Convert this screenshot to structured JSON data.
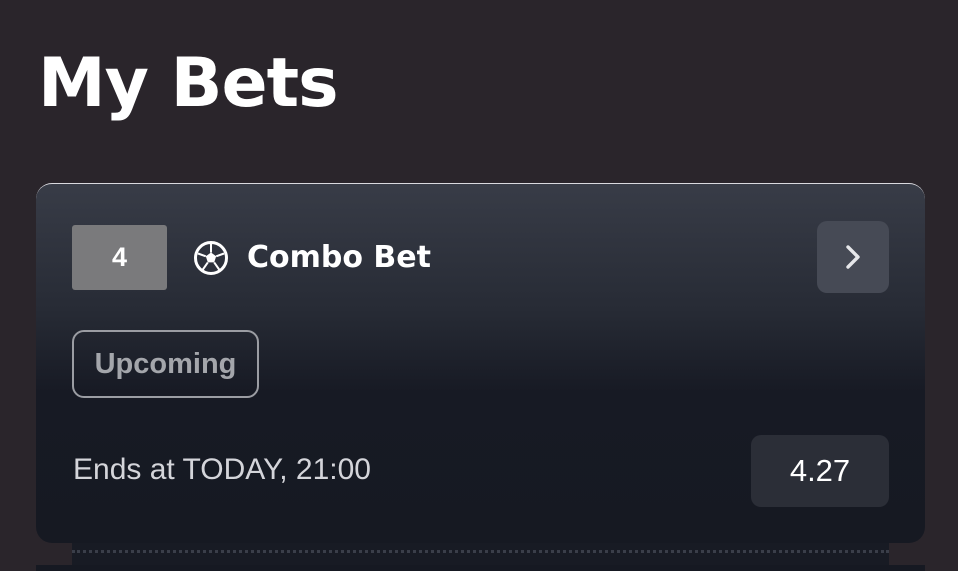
{
  "header": {
    "title": "My Bets"
  },
  "bet_card": {
    "selections_count": "4",
    "sport_icon": "soccer-ball-icon",
    "bet_type": "Combo Bet",
    "details_icon": "chevron-right-icon",
    "status": "Upcoming",
    "ends_at": "Ends at TODAY, 21:00",
    "odds": "4.27"
  },
  "colors": {
    "background": "#2a252b",
    "card_top": "#383c47",
    "card_bottom": "#161922",
    "count_badge": "#7a7a7c",
    "details_button": "#464a55",
    "odds_box": "#2b2e37",
    "status_border": "#9b9da3"
  }
}
